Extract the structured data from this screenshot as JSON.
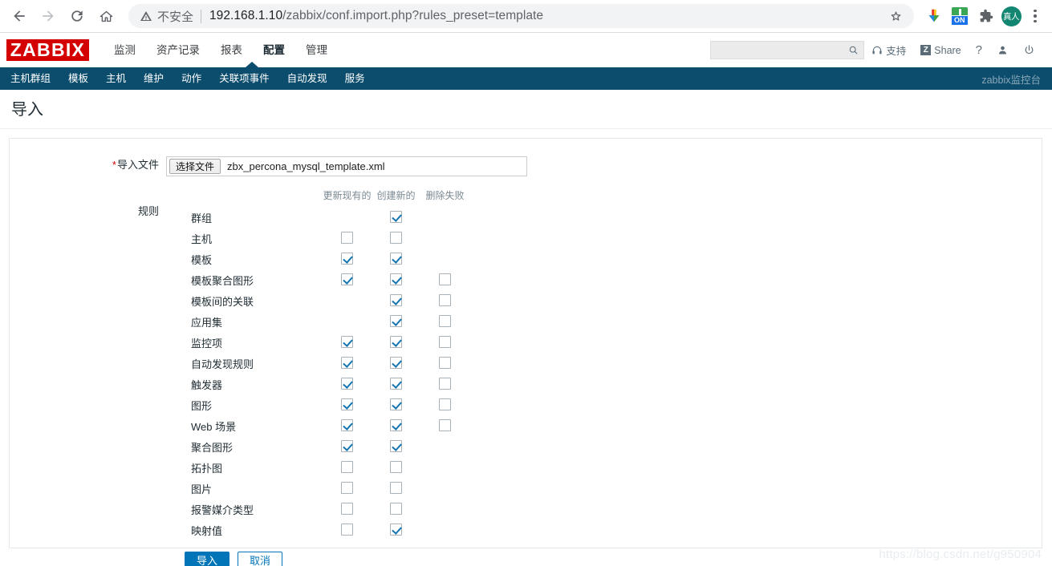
{
  "browser": {
    "back_icon": "arrow-left-icon",
    "forward_icon": "arrow-right-icon",
    "reload_icon": "reload-icon",
    "home_icon": "home-icon",
    "security_label": "不安全",
    "url": "192.168.1.10/zabbix/conf.import.php?rules_preset=template",
    "url_host": "192.168.1.10",
    "url_path": "/zabbix/conf.import.php?rules_preset=template",
    "bookmark_icon": "star-icon",
    "extensions": [
      {
        "name": "download-arrow-icon",
        "label": ""
      },
      {
        "name": "extension-on-icon",
        "label": "ON"
      },
      {
        "name": "puzzle-piece-icon",
        "label": ""
      },
      {
        "name": "profile-avatar",
        "label": "真人"
      }
    ],
    "menu_icon": "kebab-menu-icon"
  },
  "zabbix_header": {
    "logo": "ZABBIX",
    "logo_color": "#d40000",
    "menu": [
      {
        "label": "监测",
        "active": false
      },
      {
        "label": "资产记录",
        "active": false
      },
      {
        "label": "报表",
        "active": false
      },
      {
        "label": "配置",
        "active": true
      },
      {
        "label": "管理",
        "active": false
      }
    ],
    "search": {
      "value": "",
      "placeholder": "",
      "icon": "search-icon"
    },
    "links": [
      {
        "label": "支持",
        "icon": "headset-icon"
      },
      {
        "label": "Share",
        "icon": "zabbix-share-icon"
      },
      {
        "label": "?",
        "icon": "help-icon"
      },
      {
        "label": "",
        "icon": "user-icon"
      },
      {
        "label": "",
        "icon": "power-icon"
      }
    ]
  },
  "subnav": {
    "items": [
      {
        "label": "主机群组"
      },
      {
        "label": "模板"
      },
      {
        "label": "主机"
      },
      {
        "label": "维护"
      },
      {
        "label": "动作"
      },
      {
        "label": "关联项事件"
      },
      {
        "label": "自动发现"
      },
      {
        "label": "服务"
      }
    ],
    "user": "zabbix监控台",
    "bg_color": "#0c4d6d"
  },
  "page": {
    "title": "导入",
    "watermark": "https://blog.csdn.net/g950904"
  },
  "form": {
    "file_label": "导入文件",
    "file_required": "*",
    "file_button": "选择文件",
    "file_name": "zbx_percona_mysql_template.xml",
    "rules_label": "规则",
    "columns": [
      "更新现有的",
      "创建新的",
      "删除失败"
    ],
    "rows": [
      {
        "label": "群组",
        "update": null,
        "create": true,
        "delete": null
      },
      {
        "label": "主机",
        "update": false,
        "create": false,
        "delete": null
      },
      {
        "label": "模板",
        "update": true,
        "create": true,
        "delete": null
      },
      {
        "label": "模板聚合图形",
        "update": true,
        "create": true,
        "delete": false
      },
      {
        "label": "模板间的关联",
        "update": null,
        "create": true,
        "delete": false
      },
      {
        "label": "应用集",
        "update": null,
        "create": true,
        "delete": false
      },
      {
        "label": "监控项",
        "update": true,
        "create": true,
        "delete": false
      },
      {
        "label": "自动发现规则",
        "update": true,
        "create": true,
        "delete": false
      },
      {
        "label": "触发器",
        "update": true,
        "create": true,
        "delete": false
      },
      {
        "label": "图形",
        "update": true,
        "create": true,
        "delete": false
      },
      {
        "label": "Web 场景",
        "update": true,
        "create": true,
        "delete": false
      },
      {
        "label": "聚合图形",
        "update": true,
        "create": true,
        "delete": null
      },
      {
        "label": "拓扑图",
        "update": false,
        "create": false,
        "delete": null
      },
      {
        "label": "图片",
        "update": false,
        "create": false,
        "delete": null
      },
      {
        "label": "报警媒介类型",
        "update": false,
        "create": false,
        "delete": null
      },
      {
        "label": "映射值",
        "update": false,
        "create": true,
        "delete": null
      }
    ],
    "submit_label": "导入",
    "cancel_label": "取消",
    "accent_color": "#0275b8"
  }
}
